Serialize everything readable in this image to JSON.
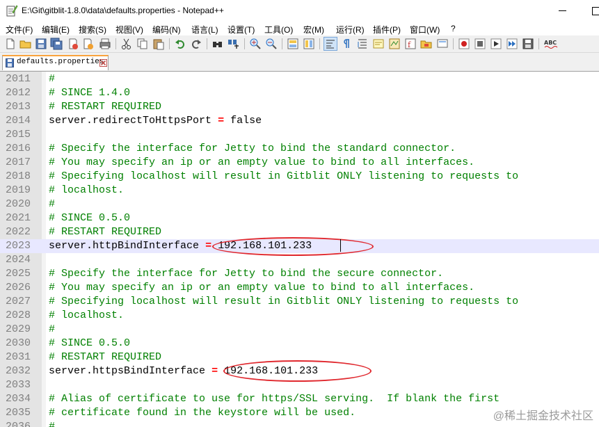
{
  "window": {
    "title": "E:\\Git\\gitblit-1.8.0\\data\\defaults.properties - Notepad++"
  },
  "menu": [
    "文件(F)",
    "编辑(E)",
    "搜索(S)",
    "视图(V)",
    "编码(N)",
    "语言(L)",
    "设置(T)",
    "工具(O)",
    "宏(M)",
    "运行(R)",
    "插件(P)",
    "窗口(W)",
    "?"
  ],
  "tab": {
    "label": "defaults.properties"
  },
  "editor": {
    "lines": [
      {
        "n": "2011",
        "type": "comment",
        "text": "#"
      },
      {
        "n": "2012",
        "type": "comment",
        "text": "# SINCE 1.4.0"
      },
      {
        "n": "2013",
        "type": "comment",
        "text": "# RESTART REQUIRED"
      },
      {
        "n": "2014",
        "type": "prop",
        "key": "server.redirectToHttpsPort",
        "eq": "=",
        "value": "false"
      },
      {
        "n": "2015",
        "type": "blank",
        "text": ""
      },
      {
        "n": "2016",
        "type": "comment",
        "text": "# Specify the interface for Jetty to bind the standard connector."
      },
      {
        "n": "2017",
        "type": "comment",
        "text": "# You may specify an ip or an empty value to bind to all interfaces."
      },
      {
        "n": "2018",
        "type": "comment",
        "text": "# Specifying localhost will result in Gitblit ONLY listening to requests to"
      },
      {
        "n": "2019",
        "type": "comment",
        "text": "# localhost."
      },
      {
        "n": "2020",
        "type": "comment",
        "text": "#"
      },
      {
        "n": "2021",
        "type": "comment",
        "text": "# SINCE 0.5.0"
      },
      {
        "n": "2022",
        "type": "comment",
        "text": "# RESTART REQUIRED"
      },
      {
        "n": "2023",
        "type": "prop",
        "key": "server.httpBindInterface",
        "eq": "=",
        "value": "192.168.101.233"
      },
      {
        "n": "2024",
        "type": "blank",
        "text": ""
      },
      {
        "n": "2025",
        "type": "comment",
        "text": "# Specify the interface for Jetty to bind the secure connector."
      },
      {
        "n": "2026",
        "type": "comment",
        "text": "# You may specify an ip or an empty value to bind to all interfaces."
      },
      {
        "n": "2027",
        "type": "comment",
        "text": "# Specifying localhost will result in Gitblit ONLY listening to requests to"
      },
      {
        "n": "2028",
        "type": "comment",
        "text": "# localhost."
      },
      {
        "n": "2029",
        "type": "comment",
        "text": "#"
      },
      {
        "n": "2030",
        "type": "comment",
        "text": "# SINCE 0.5.0"
      },
      {
        "n": "2031",
        "type": "comment",
        "text": "# RESTART REQUIRED"
      },
      {
        "n": "2032",
        "type": "prop",
        "key": "server.httpsBindInterface",
        "eq": "=",
        "value": "192.168.101.233"
      },
      {
        "n": "2033",
        "type": "blank",
        "text": ""
      },
      {
        "n": "2034",
        "type": "comment",
        "text": "# Alias of certificate to use for https/SSL serving.  If blank the first"
      },
      {
        "n": "2035",
        "type": "comment",
        "text": "# certificate found in the keystore will be used."
      },
      {
        "n": "2036",
        "type": "comment",
        "text": "#"
      }
    ]
  },
  "watermark": "@稀土掘金技术社区",
  "colors": {
    "comment": "#008000",
    "operator": "#ff0000",
    "current_line": "#e8e8ff",
    "annotation": "#e0282e",
    "active_tab_accent": "#f9a33c"
  }
}
